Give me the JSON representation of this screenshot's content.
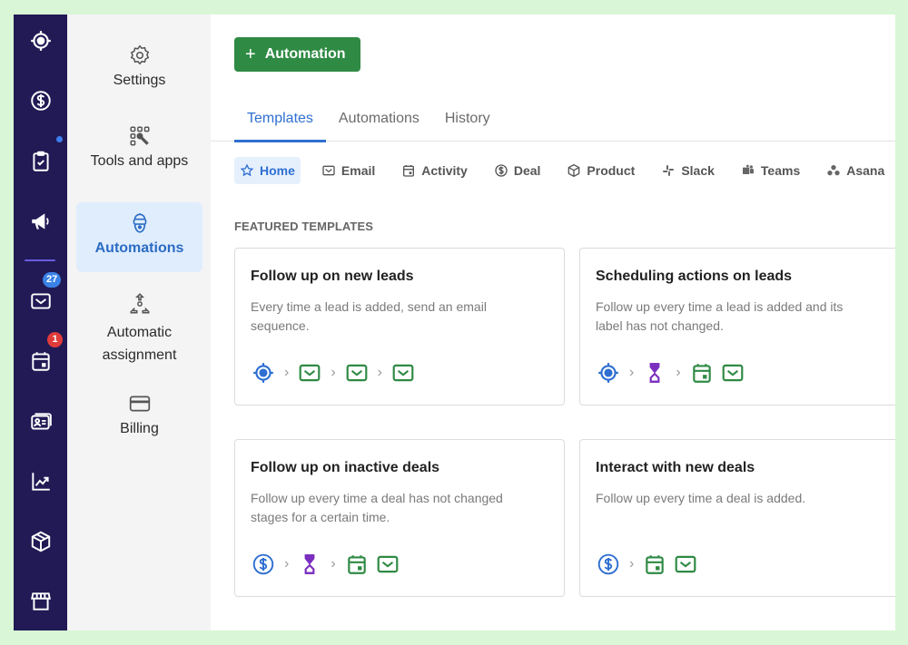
{
  "rail": {
    "items": [
      {
        "name": "leads",
        "icon": "target-icon"
      },
      {
        "name": "deals",
        "icon": "dollar-icon"
      },
      {
        "name": "activities",
        "icon": "clipboard-check-icon"
      },
      {
        "name": "campaigns",
        "icon": "megaphone-icon"
      },
      {
        "name": "mail",
        "icon": "mail-icon",
        "badge": "27"
      },
      {
        "name": "calendar",
        "icon": "calendar-icon",
        "badge": "1"
      },
      {
        "name": "contacts",
        "icon": "contact-card-icon"
      },
      {
        "name": "insights",
        "icon": "chart-icon"
      },
      {
        "name": "products",
        "icon": "box-icon"
      },
      {
        "name": "marketplace",
        "icon": "store-icon"
      }
    ]
  },
  "subnav": {
    "items": [
      {
        "label": "Settings",
        "icon": "gear-icon"
      },
      {
        "label": "Tools and apps",
        "icon": "tools-icon"
      },
      {
        "label": "Automations",
        "icon": "robot-icon",
        "active": true
      },
      {
        "label": "Automatic assignment",
        "icon": "assignment-icon"
      },
      {
        "label": "Billing",
        "icon": "credit-card-icon"
      }
    ]
  },
  "toolbar": {
    "add_label": "Automation",
    "add_icon": "+"
  },
  "tabs": [
    {
      "label": "Templates",
      "active": true
    },
    {
      "label": "Automations"
    },
    {
      "label": "History"
    }
  ],
  "categories": [
    {
      "label": "Home",
      "icon": "star-icon",
      "active": true
    },
    {
      "label": "Email",
      "icon": "mail-icon"
    },
    {
      "label": "Activity",
      "icon": "calendar-icon"
    },
    {
      "label": "Deal",
      "icon": "dollar-icon"
    },
    {
      "label": "Product",
      "icon": "box-icon"
    },
    {
      "label": "Slack",
      "icon": "slack-icon"
    },
    {
      "label": "Teams",
      "icon": "teams-icon"
    },
    {
      "label": "Asana",
      "icon": "asana-icon"
    }
  ],
  "section_label": "FEATURED TEMPLATES",
  "templates": [
    {
      "title": "Follow up on new leads",
      "description": "Every time a lead is added, send an email sequence.",
      "steps": [
        "lead",
        ">",
        "mail",
        ">",
        "mail",
        ">",
        "mail"
      ]
    },
    {
      "title": "Scheduling actions on leads",
      "description": "Follow up every time a lead is added and its label has not changed.",
      "steps": [
        "lead",
        ">",
        "hourglass",
        ">",
        "calendar",
        "mail"
      ]
    },
    {
      "title": "Follow up on inactive deals",
      "description": "Follow up every time a deal has not changed stages for a certain time.",
      "steps": [
        "deal",
        ">",
        "hourglass",
        ">",
        "calendar",
        "mail"
      ]
    },
    {
      "title": "Interact with new deals",
      "description": "Follow up every time a deal is added.",
      "steps": [
        "deal",
        ">",
        "calendar",
        "mail"
      ]
    }
  ],
  "colors": {
    "rail": "#211a55",
    "accent": "#2f6fd1",
    "primary_button": "#2f8a44",
    "step_green": "#2f8a44",
    "step_blue": "#2f6fd1",
    "step_purple": "#7b2fbf"
  }
}
